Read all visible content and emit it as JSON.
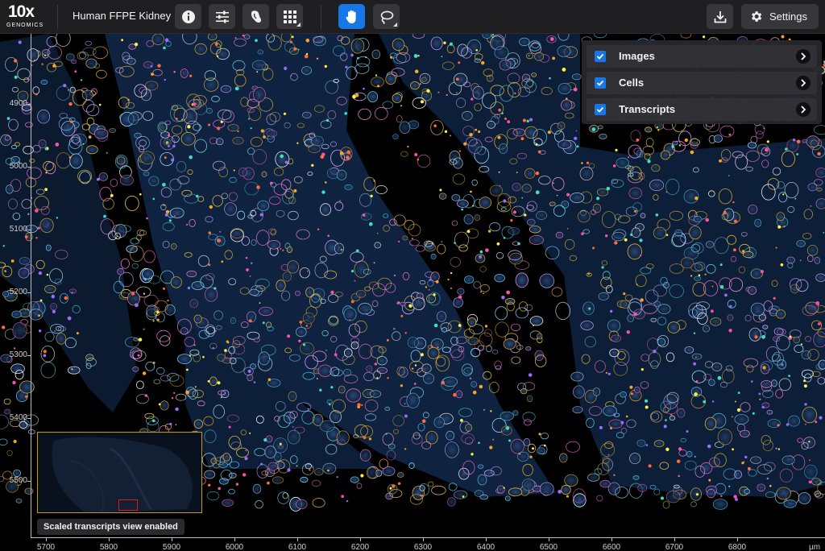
{
  "app": {
    "logo_main": "10x",
    "logo_sub": "GENOMICS",
    "dataset_title": "Human FFPE Kidney"
  },
  "toolbar": {
    "tools": [
      {
        "name": "info",
        "icon": "info-icon",
        "active": false
      },
      {
        "name": "adjustments",
        "icon": "sliders-icon",
        "active": false
      },
      {
        "name": "tissue",
        "icon": "tissue-icon",
        "active": false
      },
      {
        "name": "grid",
        "icon": "grid-icon",
        "active": false
      },
      {
        "name": "pan",
        "icon": "hand-icon",
        "active": true
      },
      {
        "name": "lasso",
        "icon": "lasso-icon",
        "active": false
      }
    ],
    "download_icon": "download-icon",
    "settings_label": "Settings",
    "settings_icon": "gear-icon"
  },
  "layers": [
    {
      "label": "Images",
      "checked": true
    },
    {
      "label": "Cells",
      "checked": true
    },
    {
      "label": "Transcripts",
      "checked": true
    }
  ],
  "axes": {
    "y_ticks": [
      "4900",
      "5000",
      "5100",
      "5200",
      "5300",
      "5400",
      "5500"
    ],
    "x_ticks": [
      "5700",
      "5800",
      "5900",
      "6000",
      "6100",
      "6200",
      "6300",
      "6400",
      "6500",
      "6600",
      "6700",
      "6800"
    ],
    "x_unit": "µm"
  },
  "minimap": {
    "status_text": "Scaled transcripts view enabled"
  },
  "colors": {
    "accent": "#1877e6",
    "toolbar_bg": "#1f1f22",
    "minimap_border": "#c69a1e",
    "minimap_viewport": "#e01919"
  }
}
